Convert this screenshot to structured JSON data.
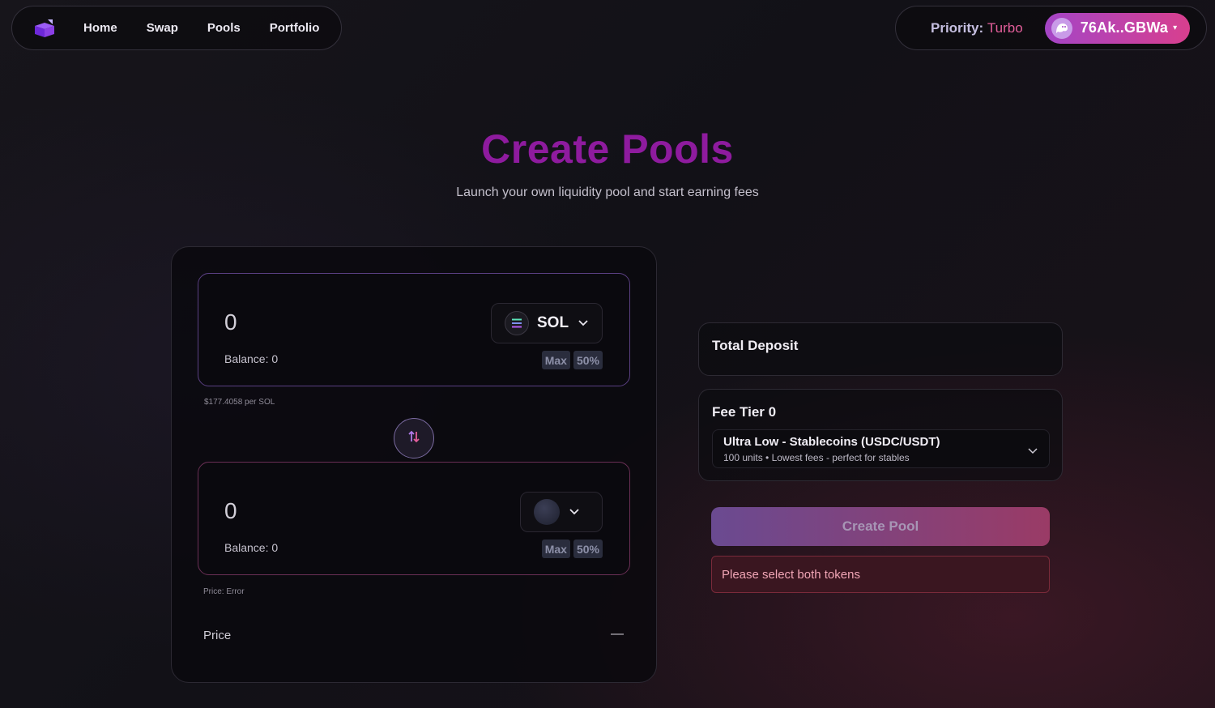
{
  "nav": {
    "links": [
      "Home",
      "Swap",
      "Pools",
      "Portfolio"
    ]
  },
  "header_right": {
    "priority_label": "Priority:",
    "priority_value": "Turbo",
    "wallet_address": "76Ak..GBWa"
  },
  "hero": {
    "title": "Create Pools",
    "subtitle": "Launch your own liquidity pool and start earning fees"
  },
  "token_a": {
    "amount": "0",
    "balance": "Balance: 0",
    "symbol": "SOL",
    "max_label": "Max",
    "half_label": "50%",
    "price_note": "$177.4058 per SOL"
  },
  "token_b": {
    "amount": "0",
    "balance": "Balance: 0",
    "max_label": "Max",
    "half_label": "50%",
    "price_note": "Price: Error"
  },
  "price": {
    "label": "Price",
    "value": "—"
  },
  "deposit": {
    "label": "Total Deposit"
  },
  "fee": {
    "label": "Fee Tier 0",
    "option_name": "Ultra Low - Stablecoins (USDC/USDT)",
    "option_desc": "100 units • Lowest fees - perfect for stables"
  },
  "actions": {
    "create_label": "Create Pool",
    "error_message": "Please select both tokens"
  },
  "colors": {
    "title": "#8e1b9e",
    "wallet_gradient_start": "#a445c6",
    "wallet_gradient_end": "#d83f8e",
    "priority_value": "#e35e9a"
  }
}
